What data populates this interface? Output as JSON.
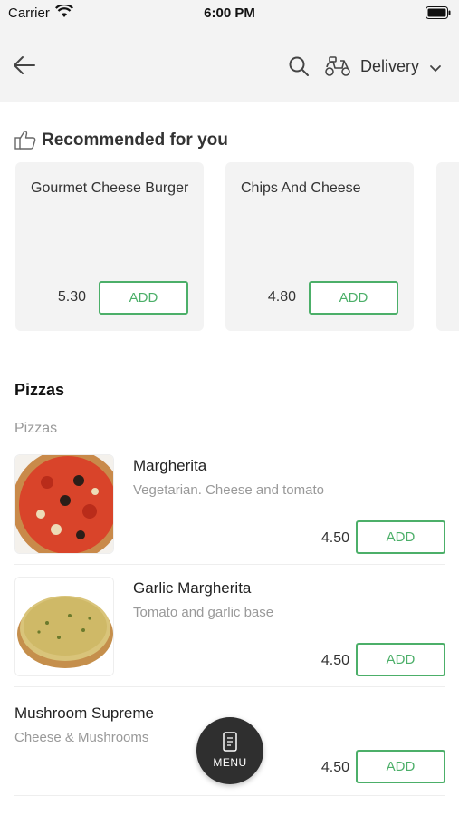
{
  "status_bar": {
    "carrier": "Carrier",
    "time": "6:00 PM"
  },
  "header": {
    "back_icon": "arrow-left-icon",
    "search_icon": "search-icon",
    "delivery_icon": "scooter-icon",
    "delivery_label": "Delivery",
    "chevron_icon": "chevron-down-icon"
  },
  "recommended": {
    "title": "Recommended for you",
    "icon": "thumbs-up-icon",
    "items": [
      {
        "name": "Gourmet Cheese Burger",
        "price": "5.30",
        "add_label": "ADD"
      },
      {
        "name": "Chips And Cheese",
        "price": "4.80",
        "add_label": "ADD"
      }
    ]
  },
  "section": {
    "title": "Pizzas",
    "subtitle": "Pizzas",
    "items": [
      {
        "name": "Margherita",
        "description": "Vegetarian. Cheese and tomato",
        "price": "4.50",
        "add_label": "ADD"
      },
      {
        "name": "Garlic Margherita",
        "description": "Tomato and garlic base",
        "price": "4.50",
        "add_label": "ADD"
      },
      {
        "name": "Mushroom Supreme",
        "description": "Cheese & Mushrooms",
        "price": "4.50",
        "add_label": "ADD"
      }
    ]
  },
  "fab": {
    "label": "MENU",
    "icon": "menu-book-icon"
  },
  "colors": {
    "accent": "#4caf69",
    "header_bg": "#f3f3f3",
    "fab_bg": "#2f2f2f"
  }
}
